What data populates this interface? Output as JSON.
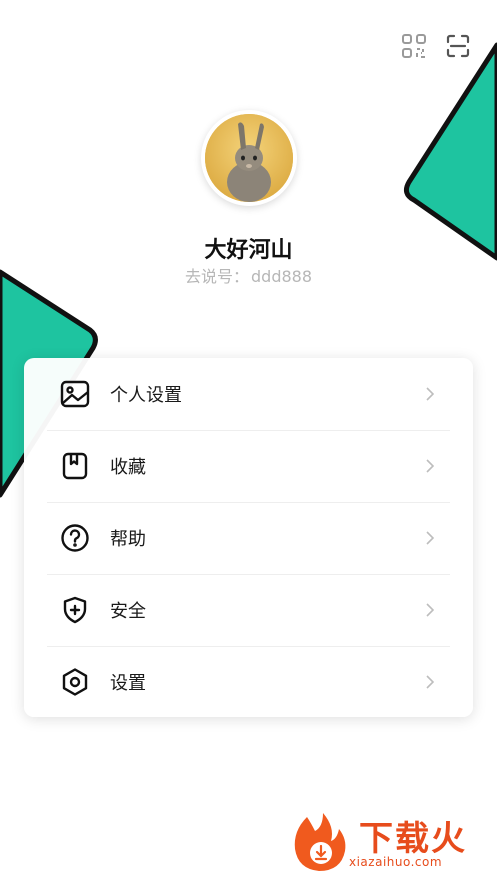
{
  "header": {
    "qr_icon": "qr-code-icon",
    "scan_icon": "scan-icon"
  },
  "profile": {
    "name": "大好河山",
    "id_label": "去说号：",
    "id_value": "ddd888"
  },
  "menu": {
    "items": [
      {
        "label": "个人设置",
        "icon": "image-icon"
      },
      {
        "label": "收藏",
        "icon": "bookmark-icon"
      },
      {
        "label": "帮助",
        "icon": "help-icon"
      },
      {
        "label": "安全",
        "icon": "shield-icon"
      },
      {
        "label": "设置",
        "icon": "hexagon-settings-icon"
      }
    ]
  },
  "watermark": {
    "brand": "下载火",
    "url": "xiazaihuo.com"
  },
  "colors": {
    "accent": "#1abc9c",
    "text_primary": "#111111",
    "text_secondary": "#b7b7b7",
    "watermark": "#e74c1c"
  }
}
